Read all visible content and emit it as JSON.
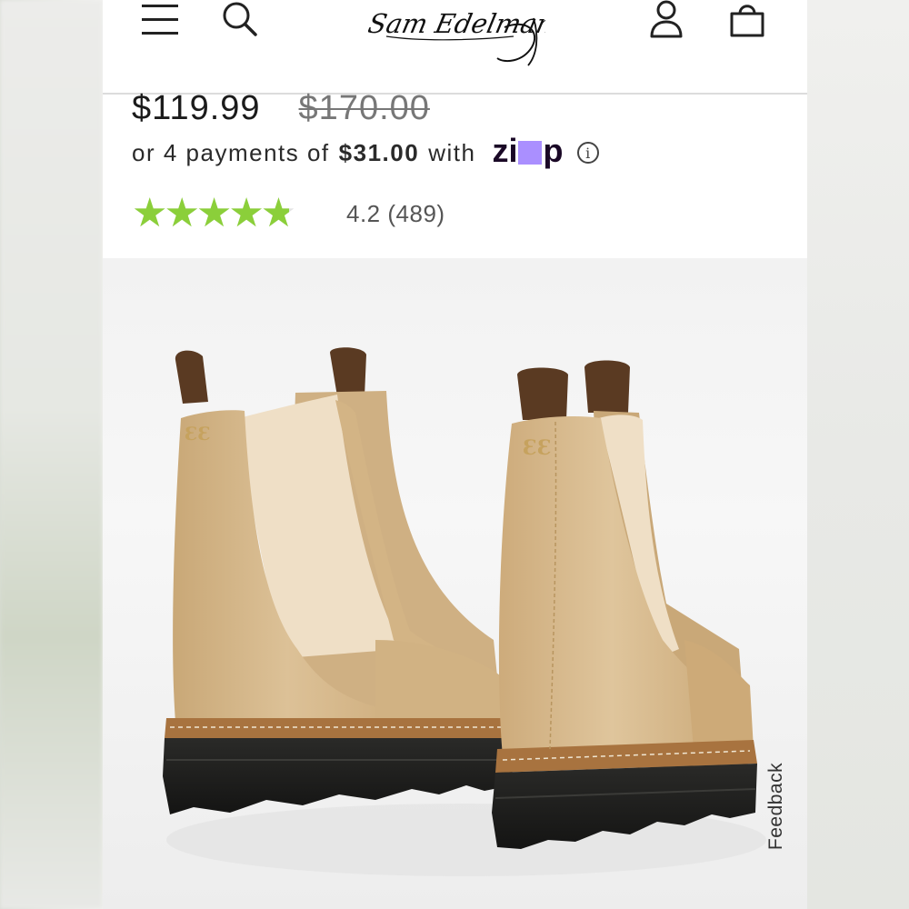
{
  "header": {
    "brand": "Sam Edelman",
    "icons": [
      "menu-icon",
      "search-icon",
      "account-icon",
      "shopping-bag-icon"
    ]
  },
  "product": {
    "sale_price": "$119.99",
    "original_price": "$170.00",
    "installments": {
      "prefix": "or 4 payments of",
      "amount": "$31.00",
      "suffix": "with",
      "provider": "zip"
    },
    "rating": {
      "value": 4.2,
      "max": 5,
      "text": "4.2 (489)"
    },
    "image": {
      "subject": "tan leather chelsea boots with black lug sole",
      "colors": {
        "leather": "#d6b98a",
        "elastic": "#f0e2cc",
        "pull_tab": "#5a3a22",
        "sole": "#1e1e1c",
        "welt": "#a8733f"
      }
    }
  },
  "feedback": {
    "label": "Feedback"
  },
  "colors": {
    "star": "#8bcf3a",
    "zip_accent": "#aa8fff",
    "zip_text": "#1a0826"
  }
}
